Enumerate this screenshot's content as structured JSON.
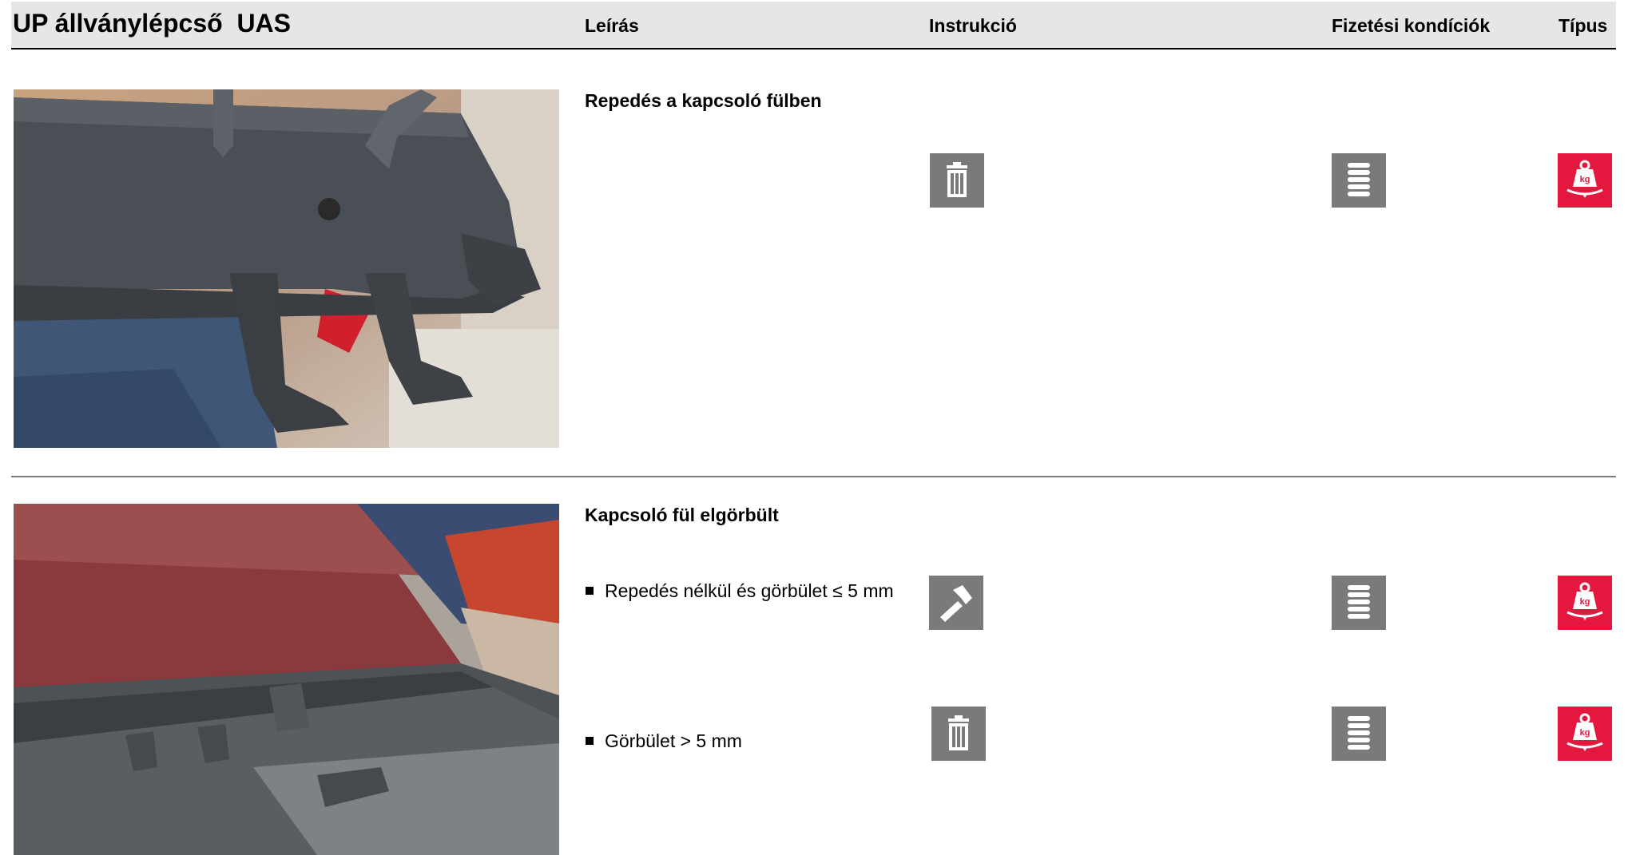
{
  "header": {
    "title": "UP állványlépcső  UAS",
    "columns": [
      "Leírás",
      "Instrukció",
      "Fizetési kondíciók",
      "Típus"
    ]
  },
  "sections": [
    {
      "heading": "Repedés a kapcsoló fülben",
      "photo": "damaged-coupling-lugs-photo",
      "rows": [
        {
          "text": "",
          "instruction_icon": "trash-icon",
          "payment_icon": "coin-stack-icon",
          "type_icon": "weight-kg-icon"
        }
      ]
    },
    {
      "heading": "Kapcsoló fül elgörbült",
      "photo": "bent-coupling-lug-photo",
      "rows": [
        {
          "text": "Repedés nélkül és görbület ≤ 5 mm",
          "instruction_icon": "hammer-icon",
          "payment_icon": "coin-stack-icon",
          "type_icon": "weight-kg-icon"
        },
        {
          "text": "Görbület > 5 mm",
          "instruction_icon": "trash-icon",
          "payment_icon": "coin-stack-icon",
          "type_icon": "weight-kg-icon"
        }
      ]
    }
  ],
  "colors": {
    "header_bg": "#e6e6e6",
    "icon_gray": "#7a7a7a",
    "icon_red": "#e4173f",
    "divider": "#7a7a7a"
  },
  "icon_labels": {
    "weight": "kg"
  }
}
